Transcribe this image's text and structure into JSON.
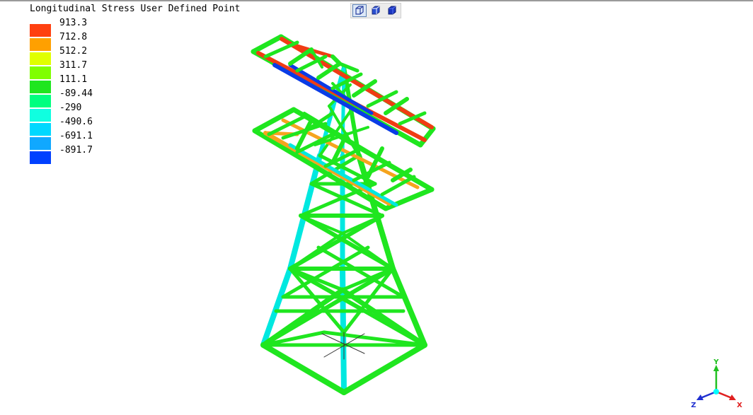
{
  "legend": {
    "title": "Longitudinal Stress User Defined Point",
    "entries": [
      {
        "value": "913.3",
        "color": "#ff4010"
      },
      {
        "value": "712.8",
        "color": "#ffa000"
      },
      {
        "value": "512.2",
        "color": "#e0ff00"
      },
      {
        "value": "311.7",
        "color": "#80ff00"
      },
      {
        "value": "111.1",
        "color": "#1fe61f"
      },
      {
        "value": "-89.44",
        "color": "#00ff7f"
      },
      {
        "value": "-290",
        "color": "#10ffe0"
      },
      {
        "value": "-490.6",
        "color": "#00d8ff"
      },
      {
        "value": "-691.1",
        "color": "#10a8ff"
      },
      {
        "value": "-891.7",
        "color": "#0040ff"
      }
    ]
  },
  "toolbar": {
    "buttons": [
      {
        "icon": "wireframe-cube-icon",
        "active": true
      },
      {
        "icon": "shaded-cube-icon",
        "active": false
      },
      {
        "icon": "solid-cube-icon",
        "active": false
      }
    ]
  },
  "axes": {
    "x": "X",
    "y": "Y",
    "z": "Z",
    "x_color": "#e02020",
    "y_color": "#20c020",
    "z_color": "#2030d0"
  },
  "colors": {
    "member_green": "#1fe61f",
    "leg_cyan": "#00e8e0",
    "stress_red": "#f03c14",
    "stress_blue": "#0a3ce6",
    "stress_orange": "#f5a41e"
  }
}
